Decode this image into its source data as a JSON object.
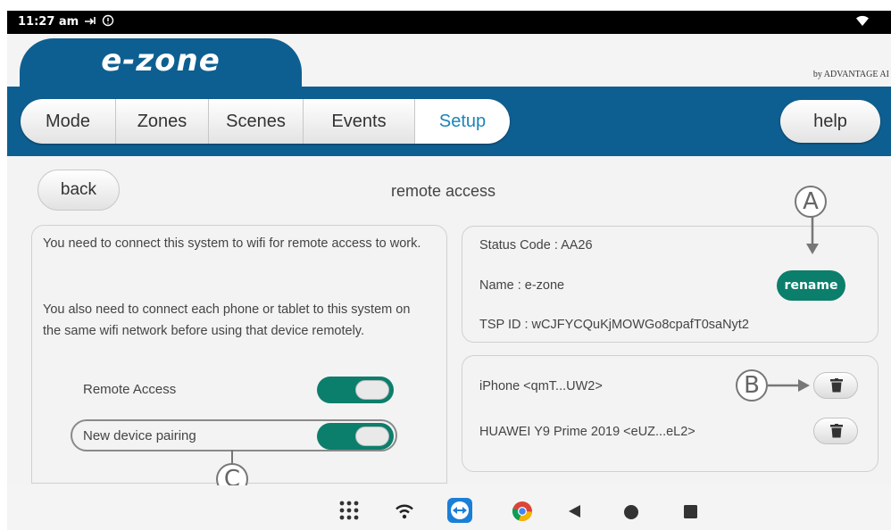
{
  "status_bar": {
    "time": "11:27 am",
    "icons": [
      "signal-arrows-icon",
      "alert-circle-icon",
      "wifi-full-icon"
    ]
  },
  "header": {
    "logo": "e-zone",
    "brand": "by ADVANTAGE AI"
  },
  "tabs": [
    {
      "label": "Mode",
      "active": false
    },
    {
      "label": "Zones",
      "active": false
    },
    {
      "label": "Scenes",
      "active": false
    },
    {
      "label": "Events",
      "active": false
    },
    {
      "label": "Setup",
      "active": true
    }
  ],
  "help_label": "help",
  "back_label": "back",
  "page_title": "remote access",
  "left_panel": {
    "para1": "You need to connect this system to wifi for remote access to work.",
    "para2": "You also need to connect each phone or tablet to this system on the same wifi network before using that device remotely.",
    "remote_access_label": "Remote Access",
    "remote_access_on": true,
    "pairing_label": "New device pairing",
    "pairing_on": true
  },
  "system_info": {
    "status_code": "Status Code : AA26",
    "name": "Name : e-zone",
    "tsp_id": "TSP ID : wCJFYCQuKjMOWGo8cpafT0saNyt2",
    "rename_label": "rename"
  },
  "devices": [
    {
      "name": "iPhone <qmT...UW2>"
    },
    {
      "name": "HUAWEI Y9 Prime 2019 <eUZ...eL2>"
    }
  ],
  "callouts": {
    "a": "A",
    "b": "B",
    "c": "C"
  },
  "colors": {
    "header_blue": "#0e5f91",
    "toggle_green": "#0c7e6c",
    "active_tab_text": "#1a86b8"
  },
  "nav_icons": [
    "app-grid-icon",
    "wifi-icon",
    "teamviewer-icon",
    "chrome-icon",
    "nav-back-icon",
    "nav-home-icon",
    "nav-recents-icon"
  ]
}
